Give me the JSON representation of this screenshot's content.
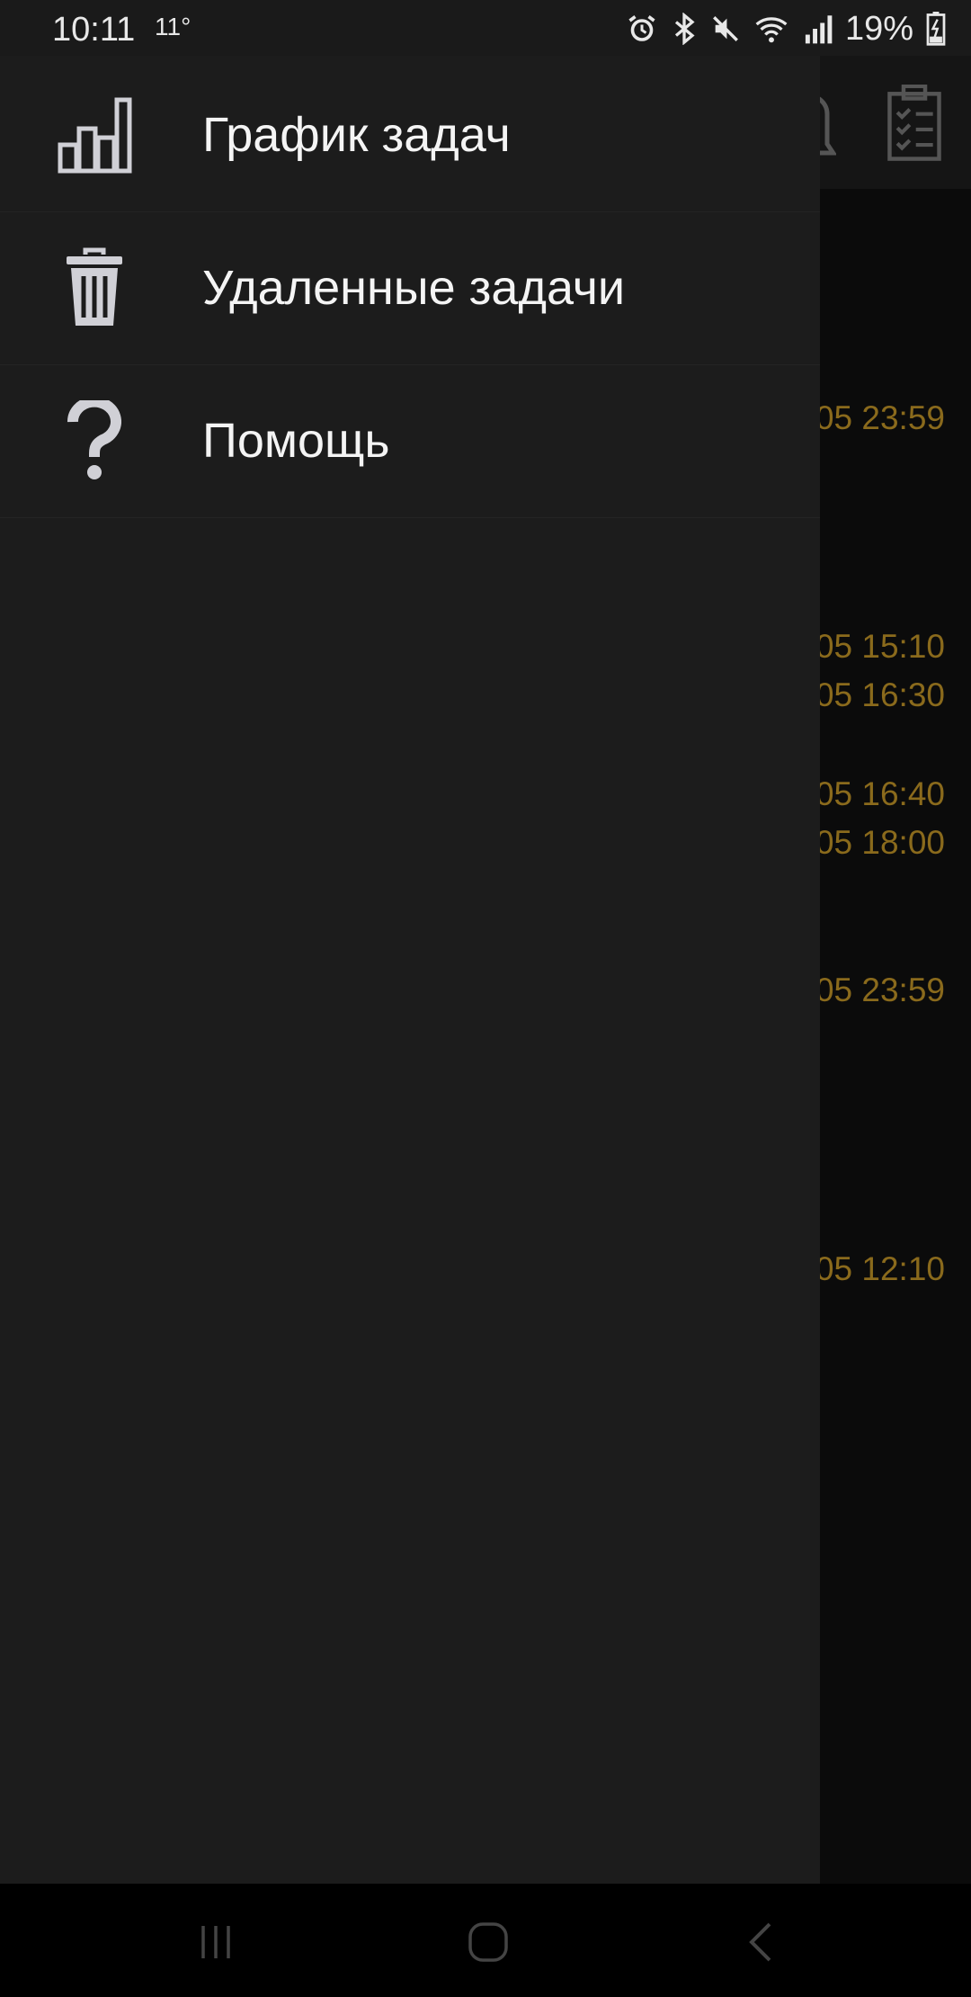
{
  "status_bar": {
    "time": "10:11",
    "temperature": "11°",
    "battery": "19%",
    "icons": [
      "alarm-icon",
      "bluetooth-icon",
      "mute-icon",
      "wifi-icon",
      "signal-icon",
      "battery-charging-icon"
    ]
  },
  "drawer": {
    "items": [
      {
        "label": "График задач",
        "icon": "bar-chart-icon"
      },
      {
        "label": "Удаленные задачи",
        "icon": "trash-icon"
      },
      {
        "label": "Помощь",
        "icon": "help-icon"
      }
    ]
  },
  "background": {
    "toolbar_icons": [
      "notification-icon",
      "clipboard-checklist-icon"
    ],
    "times": [
      "05 23:59",
      "05 15:10",
      "05 16:30",
      "05 16:40",
      "05 18:00",
      "05 23:59",
      "05 12:10"
    ],
    "accent_color": "#8a6a1c"
  },
  "nav_bar": {
    "icons": [
      "recents-icon",
      "home-icon",
      "back-icon"
    ]
  }
}
